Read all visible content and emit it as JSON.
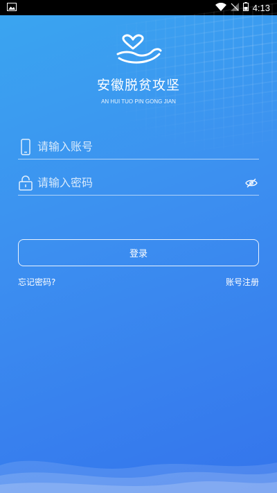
{
  "status_bar": {
    "time": "4:13"
  },
  "app": {
    "title": "安徽脱贫攻坚",
    "subtitle": "AN HUI TUO PIN GONG JIAN"
  },
  "form": {
    "account_placeholder": "请输入账号",
    "password_placeholder": "请输入密码",
    "login_label": "登录",
    "forgot_label": "忘记密码?",
    "register_label": "账号注册"
  },
  "colors": {
    "bg_top": "#3aa6f0",
    "bg_bottom": "#3474ec"
  },
  "icons": {
    "logo": "heart-hands-logo",
    "account": "phone-icon",
    "password": "lock-icon",
    "visibility": "eye-off-icon"
  }
}
